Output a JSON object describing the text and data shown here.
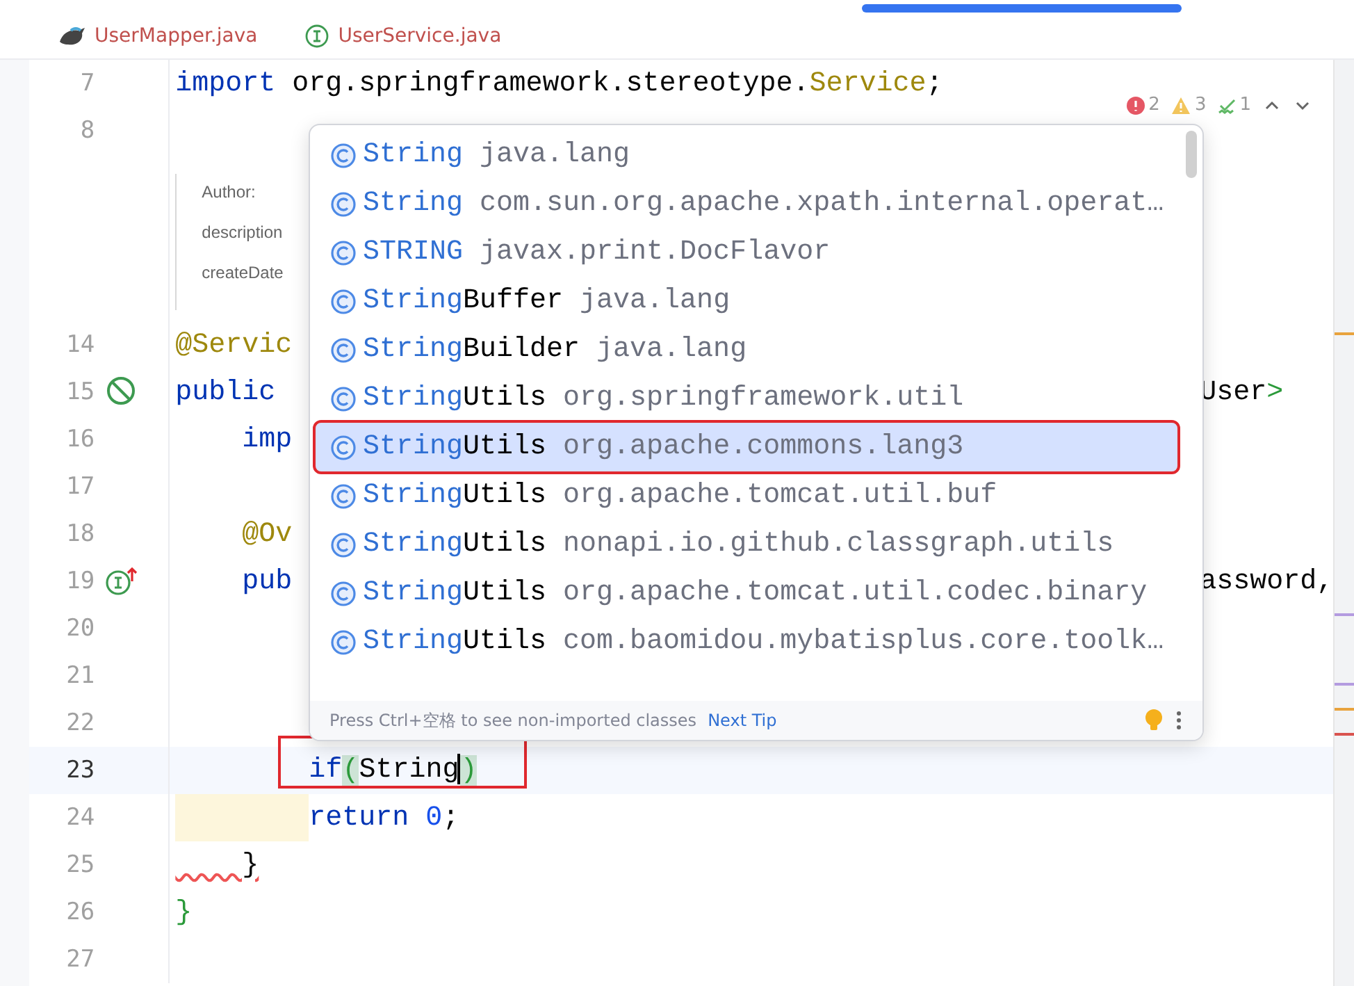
{
  "tabs": [
    {
      "label": "UserMapper.java",
      "kind": "mapper"
    },
    {
      "label": "UserService.java",
      "kind": "interface"
    }
  ],
  "inspections": {
    "errors": "2",
    "warnings": "3",
    "typos": "1"
  },
  "lines": [
    {
      "kind": "code",
      "number": "7",
      "current": false,
      "marked_indent": false,
      "framed": false,
      "left": [
        {
          "text": "import",
          "kind": "keyword"
        },
        {
          "text": " org.springframework.stereotype.",
          "kind": "plain"
        },
        {
          "text": "Service",
          "kind": "annotation"
        },
        {
          "text": ";",
          "kind": "plain"
        }
      ]
    },
    {
      "kind": "code",
      "number": "8",
      "current": false,
      "marked_indent": false,
      "framed": false
    },
    {
      "kind": "doc",
      "labels": [
        "Author:",
        "description",
        "createDate"
      ]
    },
    {
      "kind": "code",
      "number": "14",
      "current": false,
      "marked_indent": false,
      "framed": false,
      "left": [
        {
          "text": "@Servic",
          "kind": "annotation"
        }
      ]
    },
    {
      "kind": "code",
      "number": "15",
      "gutter": {
        "kind": "no-entry"
      },
      "current": false,
      "marked_indent": false,
      "framed": false,
      "left": [
        {
          "text": "public",
          "kind": "keyword"
        }
      ],
      "right": [
        {
          "text": "User",
          "kind": "plain"
        },
        {
          "text": ">",
          "kind": "brace"
        }
      ]
    },
    {
      "kind": "code",
      "number": "16",
      "current": false,
      "marked_indent": false,
      "framed": false,
      "left": [
        {
          "text": "    imp",
          "kind": "keyword"
        }
      ]
    },
    {
      "kind": "code",
      "number": "17",
      "current": false,
      "marked_indent": false,
      "framed": false
    },
    {
      "kind": "code",
      "number": "18",
      "current": false,
      "marked_indent": false,
      "framed": false,
      "left": [
        {
          "text": "    @Ov",
          "kind": "annotation"
        }
      ]
    },
    {
      "kind": "code",
      "number": "19",
      "gutter": {
        "kind": "implements"
      },
      "current": false,
      "marked_indent": false,
      "framed": false,
      "left": [
        {
          "text": "    pub",
          "kind": "keyword"
        }
      ],
      "right": [
        {
          "text": "assword,",
          "kind": "plain"
        }
      ]
    },
    {
      "kind": "code",
      "number": "20",
      "current": false,
      "marked_indent": false,
      "framed": false
    },
    {
      "kind": "code",
      "number": "21",
      "current": false,
      "marked_indent": false,
      "framed": false
    },
    {
      "kind": "code",
      "number": "22",
      "current": false,
      "marked_indent": false,
      "framed": false
    },
    {
      "kind": "code",
      "number": "23",
      "current": true,
      "marked_indent": false,
      "framed": true,
      "left": [
        {
          "text": "        if",
          "kind": "keyword"
        },
        {
          "text": "(",
          "kind": "paren"
        },
        {
          "text": "String",
          "kind": "plain",
          "caret": true
        },
        {
          "text": ")",
          "kind": "paren"
        }
      ]
    },
    {
      "kind": "code",
      "number": "24",
      "current": false,
      "marked_indent": true,
      "framed": false,
      "left": [
        {
          "text": "return",
          "kind": "keyword"
        },
        {
          "text": " 0",
          "kind": "number"
        },
        {
          "text": ";",
          "kind": "plain"
        }
      ]
    },
    {
      "kind": "code",
      "number": "25",
      "current": false,
      "marked_indent": false,
      "framed": false,
      "left": [
        {
          "text": "    }",
          "kind": "plain",
          "error": true
        }
      ]
    },
    {
      "kind": "code",
      "number": "26",
      "current": false,
      "marked_indent": false,
      "framed": false,
      "left": [
        {
          "text": "}",
          "kind": "brace"
        }
      ]
    },
    {
      "kind": "code",
      "number": "27",
      "current": false,
      "marked_indent": false,
      "framed": false
    }
  ],
  "completion": {
    "items": [
      {
        "match": "String",
        "package": "java.lang",
        "selected": false
      },
      {
        "match": "String",
        "package": "com.sun.org.apache.xpath.internal.operat…",
        "selected": false
      },
      {
        "match": "STRING",
        "package": "javax.print.DocFlavor",
        "selected": false
      },
      {
        "match": "String",
        "rest": "Buffer",
        "package": "java.lang",
        "selected": false
      },
      {
        "match": "String",
        "rest": "Builder",
        "package": "java.lang",
        "selected": false
      },
      {
        "match": "String",
        "rest": "Utils",
        "package": "org.springframework.util",
        "selected": false
      },
      {
        "match": "String",
        "rest": "Utils",
        "package": "org.apache.commons.lang3",
        "selected": true
      },
      {
        "match": "String",
        "rest": "Utils",
        "package": "org.apache.tomcat.util.buf",
        "selected": false
      },
      {
        "match": "String",
        "rest": "Utils",
        "package": "nonapi.io.github.classgraph.utils",
        "selected": false
      },
      {
        "match": "String",
        "rest": "Utils",
        "package": "org.apache.tomcat.util.codec.binary",
        "selected": false
      },
      {
        "match": "String",
        "rest": "Utils",
        "package": "com.baomidou.mybatisplus.core.toolk…",
        "selected": false
      }
    ],
    "hint": "Press Ctrl+空格 to see non-imported classes",
    "link": "Next Tip"
  }
}
